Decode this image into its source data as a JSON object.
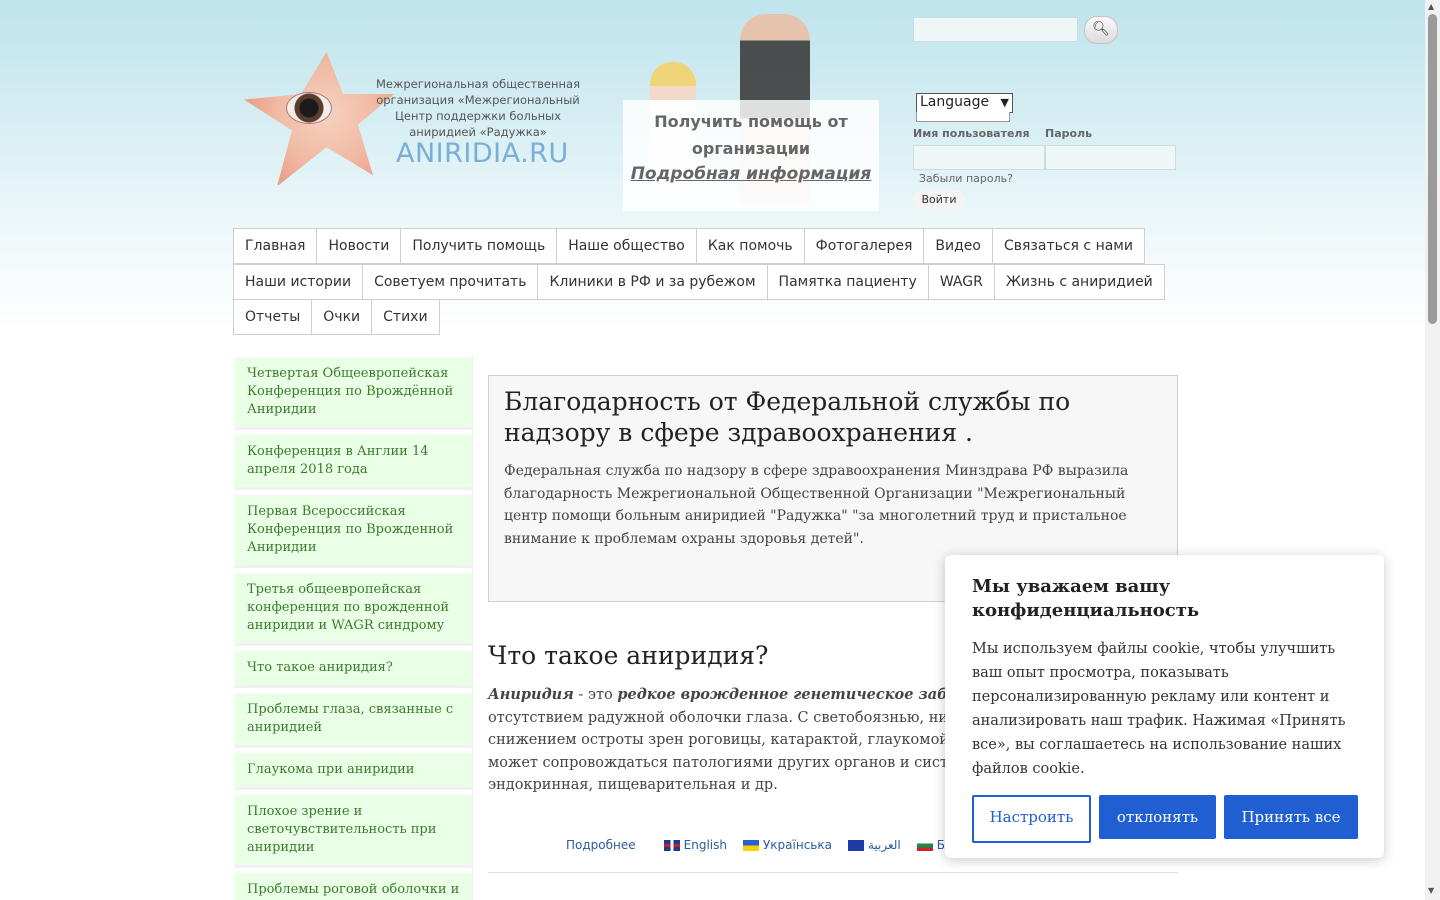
{
  "header": {
    "org_text": "Межрегиональная общественная организация «Межрегиональный Центр поддержки больных аниридией «Радужка»",
    "site_name": "ANIRIDIA.RU",
    "help_title": "Получить помощь от организации",
    "help_link": "Подробная информация",
    "search_button_icon": "search-icon",
    "language_select": "Language",
    "username_label": "Имя пользователя",
    "password_label": "Пароль",
    "forgot_password": "Забыли пароль?",
    "login_button": "Войти"
  },
  "menu": {
    "row1": [
      "Главная",
      "Новости",
      "Получить помощь",
      "Наше общество",
      "Как помочь",
      "Фотогалерея",
      "Видео",
      "Связаться с нами"
    ],
    "row2": [
      "Наши истории",
      "Советуем прочитать",
      "Клиники в РФ и за рубежом",
      "Памятка пациенту",
      "WAGR",
      "Жизнь с аниридией"
    ],
    "row3": [
      "Отчеты",
      "Очки",
      "Стихи"
    ]
  },
  "sidebar": {
    "items": [
      "Четвертая Общеевропейская Конференция по Врождённой Аниридии",
      "Конференция в Англии 14 апреля 2018 года",
      "Первая Всероссийская Конференция по Врожденной Аниридии",
      "Третья общеевропейская конференция по врожденной аниридии и WAGR синдрому",
      "Что такое аниридия?",
      "Проблемы глаза, связанные с аниридией",
      "Глаукома при аниридии",
      "Плохое зрение и светочувствительность при аниридии",
      "Проблемы роговой оболочки и хрусталика"
    ]
  },
  "news": {
    "title": "Благодарность от Федеральной службы по надзору в сфере здравоохранения .",
    "text": "Федеральная служба по надзору в сфере здравоохранения Минздрава РФ выразила благодарность Межрегиональной Общественной Организации \"Межрегиональный центр помощи больным аниридией \"Радужка\" \"за многолетний труд и пристальное внимание к проблемам охраны здоровья детей\"."
  },
  "article": {
    "title": "Что такое аниридия?",
    "term": "Аниридия",
    "intro": " - это ",
    "emph": "редкое врожденное генетическое забол",
    "body": "характеризующееся отсутствием радужной оболочки глаза. С светобоязнью, нистагмом, сильным снижением остроты зрен роговицы, катарактой, глаукомой и другими проблемами гла может сопровождаться патологиями других органов и систем мочеполовая, эндокринная, пищеварительная и др.",
    "more": "Подробнее",
    "langs": [
      "English",
      "Українська",
      "العربية",
      "Бъл"
    ]
  },
  "cookie": {
    "title": "Мы уважаем вашу конфиденциальность",
    "text": "Мы используем файлы cookie, чтобы улучшить ваш опыт просмотра, показывать персонализированную рекламу или контент и анализировать наш трафик. Нажимая «Принять все», вы соглашаетесь на использование наших файлов cookie.",
    "customize": "Настроить",
    "reject": "отклонять",
    "accept": "Принять все"
  },
  "colors": {
    "accent": "#1f5fd1",
    "sidebar_bg": "#e9ffe6",
    "sidebar_text": "#3c7a2c",
    "link": "#2c5aa0"
  }
}
